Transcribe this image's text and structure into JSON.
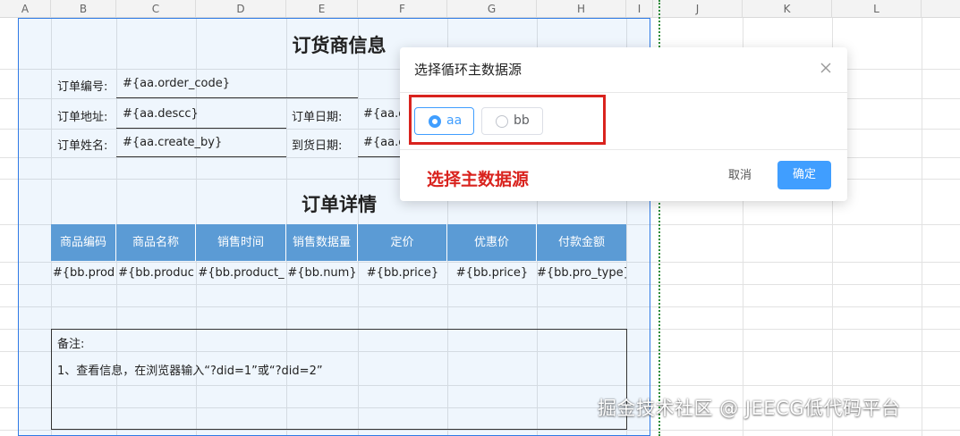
{
  "columns": [
    "A",
    "B",
    "C",
    "D",
    "E",
    "F",
    "G",
    "H",
    "I",
    "J",
    "K",
    "L"
  ],
  "supplier": {
    "title": "订货商信息",
    "order_code_label": "订单编号:",
    "order_code_value": "#{aa.order_code}",
    "address_label": "订单地址:",
    "address_value": "#{aa.descc}",
    "order_date_label": "订单日期:",
    "order_date_value": "#{aa.or",
    "name_label": "订单姓名:",
    "name_value": "#{aa.create_by}",
    "arrival_label": "到货日期:",
    "arrival_value": "#{aa.cr"
  },
  "details": {
    "title": "订单详情",
    "headers": [
      "商品编码",
      "商品名称",
      "销售时间",
      "销售数据量",
      "定价",
      "优惠价",
      "付款金额"
    ],
    "row": [
      "#{bb.prod",
      "#{bb.produc",
      "#{bb.product_",
      "#{bb.num}",
      "#{bb.price}",
      "#{bb.price}",
      "#{bb.pro_type}"
    ]
  },
  "notes": {
    "label": "备注:",
    "text": "1、查看信息，在浏览器输入“?did=1”或“?did=2”"
  },
  "dialog": {
    "title": "选择循环主数据源",
    "options": [
      {
        "label": "aa",
        "selected": true
      },
      {
        "label": "bb",
        "selected": false
      }
    ],
    "annotation": "选择主数据源",
    "cancel_label": "取消",
    "ok_label": "确定"
  },
  "watermark": "掘金技术社区 @ JEECG低代码平台",
  "colors": {
    "accent": "#409eff",
    "header_blue": "#5b9bd5",
    "annotation_red": "#d9231e",
    "selection_border": "#2f7ae5"
  },
  "icons": {
    "close": "close-icon"
  }
}
